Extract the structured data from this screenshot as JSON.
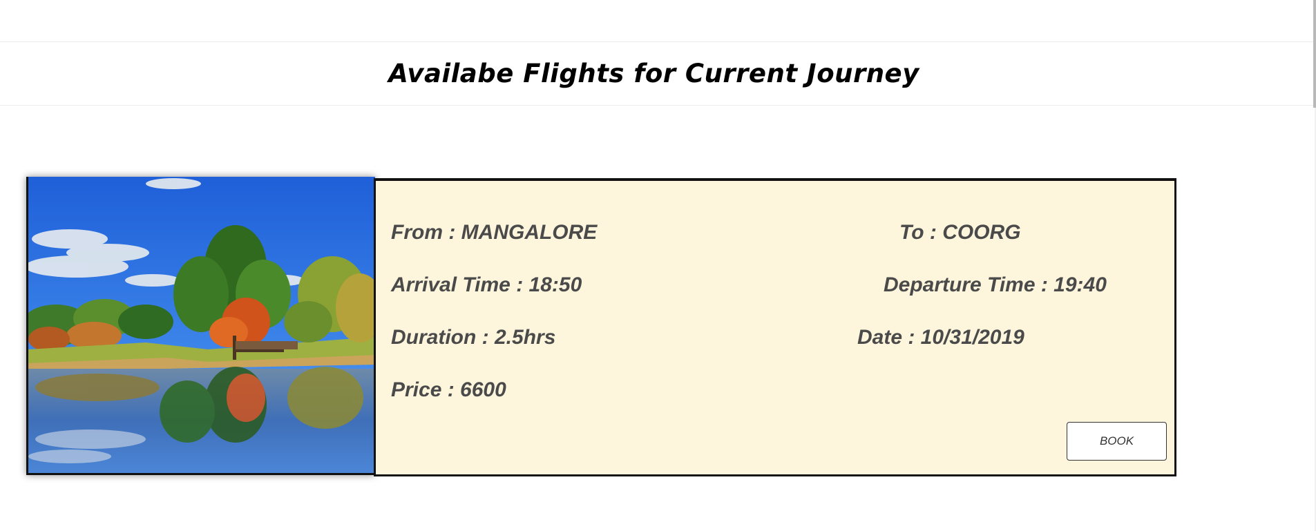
{
  "header": {
    "title": "Availabe Flights for Current Journey"
  },
  "flight": {
    "from": "From : MANGALORE",
    "to": "To : COORG",
    "arrival": "Arrival Time : 18:50",
    "departure": "Departure Time : 19:40",
    "duration": "Duration : 2.5hrs",
    "date": "Date : 10/31/2019",
    "price": "Price : 6600",
    "book_label": "BOOK"
  },
  "colors": {
    "card_background": "#fdf5dc",
    "field_text": "#4a4a4a",
    "border": "#111111"
  }
}
